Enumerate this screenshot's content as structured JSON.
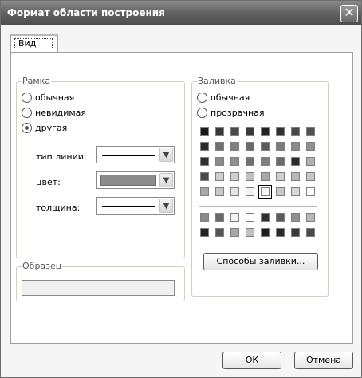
{
  "window": {
    "title": "Формат области построения",
    "close_glyph": "✕"
  },
  "tabs": [
    {
      "label": "Вид"
    }
  ],
  "border_group": {
    "title": "Рамка",
    "options": [
      {
        "label": "обычная",
        "checked": false
      },
      {
        "label": "невидимая",
        "checked": false
      },
      {
        "label": "другая",
        "checked": true
      }
    ],
    "line_type_label": "тип линии:",
    "color_label": "цвет:",
    "thickness_label": "толщина:",
    "color_value": "#8c8c8c"
  },
  "sample_group": {
    "title": "Образец"
  },
  "fill_group": {
    "title": "Заливка",
    "options": [
      {
        "label": "обычная",
        "checked": false
      },
      {
        "label": "прозрачная",
        "checked": false
      }
    ],
    "palette_rows": [
      [
        "#1a1a1a",
        "#3a3a3a",
        "#4a4a4a",
        "#3a3a3a",
        "#202020",
        "#303030",
        "#484848",
        "#505050"
      ],
      [
        "#2a2a2a",
        "#707070",
        "#808080",
        "#6a6a6a",
        "#5a5a5a",
        "#7a7a7a",
        "#8a8a8a",
        "#909090"
      ],
      [
        "#2e2e2e",
        "#8a8a8a",
        "#909090",
        "#707070",
        "#7e7e7e",
        "#6a6a6a",
        "#2a2a2a",
        "#b0b0b0"
      ],
      [
        "#4a4a4a",
        "#cfcfcf",
        "#d0d0d0",
        "#c0c0c0",
        "#a8a8a8",
        "#cfcfcf",
        "#b8b8b8",
        "#c8c8c8"
      ],
      [
        "#a8a8a8",
        "#c8c8c8",
        "#e6e6e6",
        "#f2f2f2",
        "#f7f7f7",
        "#c8c8c8",
        "#d8d8d8",
        "#ffffff"
      ]
    ],
    "palette_rows_2": [
      [
        "#8a8a8a",
        "#6a6a6a",
        "#f5f5f5",
        "#ffffff",
        "#303030",
        "#5a5a5a",
        "#909090",
        "#b8b8b8"
      ],
      [
        "#222222",
        "#555555",
        "#a8a8a8",
        "#c0c0c0",
        "#1e1e1e",
        "#2a2a2a",
        "#3a3a3a",
        "#4a4a4a"
      ]
    ],
    "selected_cell": {
      "row": 4,
      "col": 4
    },
    "fill_effects_button": "Способы заливки..."
  },
  "footer": {
    "ok": "ОК",
    "cancel": "Отмена"
  }
}
